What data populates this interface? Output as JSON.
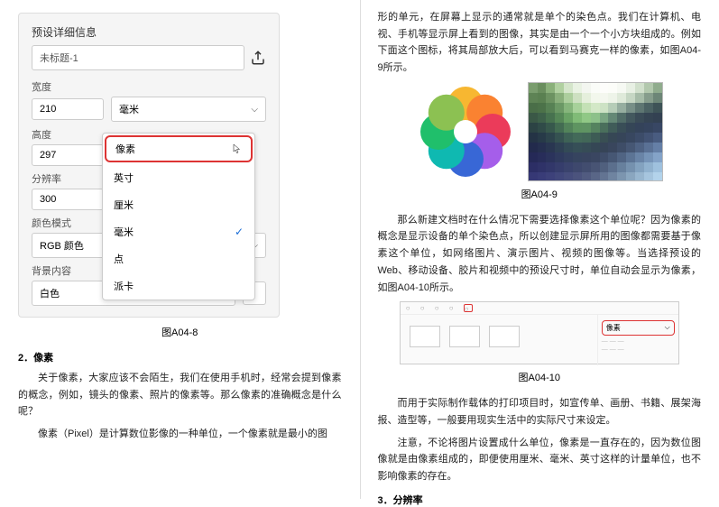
{
  "left": {
    "panel_title": "预设详细信息",
    "doc_name": "未标题-1",
    "labels": {
      "width": "宽度",
      "height": "高度",
      "res": "分辨率",
      "color": "颜色模式",
      "bg": "背景内容"
    },
    "values": {
      "width": "210",
      "height": "297",
      "res": "300"
    },
    "width_unit": "毫米",
    "color_mode": "RGB 颜色",
    "bg_mode": "白色",
    "dropdown": [
      "像素",
      "英寸",
      "厘米",
      "毫米",
      "点",
      "派卡"
    ],
    "dd_selected": "毫米",
    "dd_highlight": "像素",
    "caption": "图A04-8",
    "h": "2．像素",
    "p1": "关于像素，大家应该不会陌生，我们在使用手机时，经常会提到像素的概念，例如，镜头的像素、照片的像素等。那么像素的准确概念是什么呢？",
    "p2": "像素（Pixel）是计算数位影像的一种单位，一个像素就是最小的图"
  },
  "right": {
    "p1": "形的单元，在屏幕上显示的通常就是单个的染色点。我们在计算机、电视、手机等显示屏上看到的图像，其实是由一个一个小方块组成的。例如下面这个图标，将其局部放大后，可以看到马赛克一样的像素，如图A04-9所示。",
    "cap9": "图A04-9",
    "p2": "那么新建文档时在什么情况下需要选择像素这个单位呢？因为像素的概念是显示设备的单个染色点，所以创建显示屏所用的图像都需要基于像素这个单位，如网络图片、演示图片、视频的图像等。当选择预设的Web、移动设备、胶片和视频中的预设尺寸时，单位自动会显示为像素，如图A04-10所示。",
    "cap10": "图A04-10",
    "ui_opt_label": "像素",
    "p3": "而用于实际制作载体的打印项目时，如宣传单、画册、书籍、展架海报、造型等，一般要用现实生活中的实际尺寸来设定。",
    "p4": "注意，不论将图片设置成什么单位，像素是一直存在的，因为数位图像就是由像素组成的，即便使用厘米、毫米、英寸这样的计量单位，也不影响像素的存在。",
    "h3": "3．分辨率"
  }
}
